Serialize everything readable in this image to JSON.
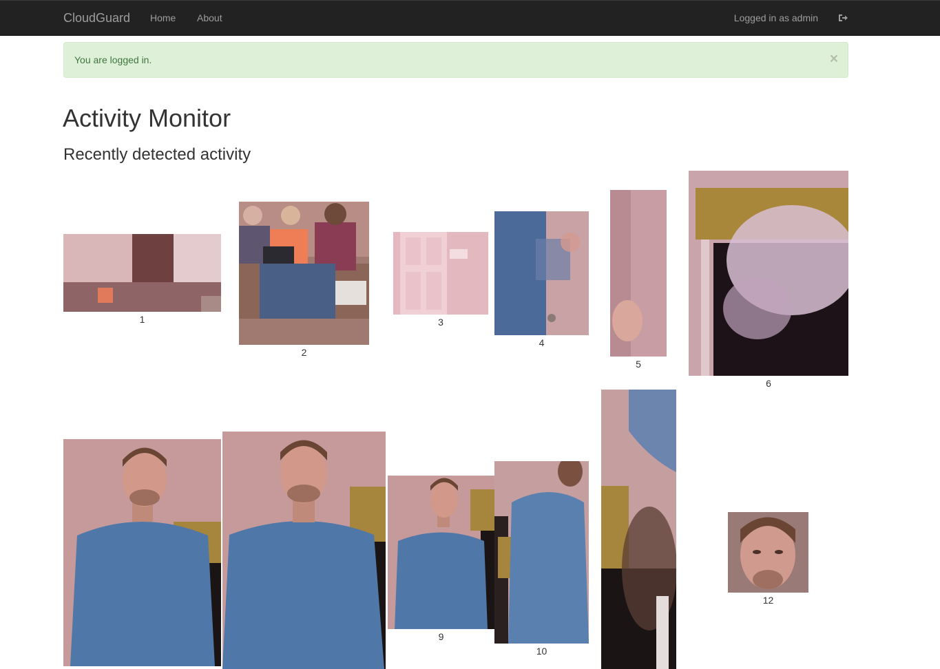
{
  "navbar": {
    "brand": "CloudGuard",
    "links": [
      "Home",
      "About"
    ],
    "user_text": "Logged in as admin",
    "logout_icon": "sign-out-icon"
  },
  "alert": {
    "message": "You are logged in.",
    "close_label": "×",
    "color": "#dff0d8"
  },
  "page": {
    "title": "Activity Monitor",
    "subtitle": "Recently detected activity"
  },
  "detections": [
    {
      "label": "1",
      "scene": "living room wide view"
    },
    {
      "label": "2",
      "scene": "three people on couch with laptop"
    },
    {
      "label": "3",
      "scene": "white door"
    },
    {
      "label": "4",
      "scene": "person in blue shirt moving, blurred"
    },
    {
      "label": "5",
      "scene": "motion blur close-up"
    },
    {
      "label": "6",
      "scene": "window with curtain, motion blur"
    },
    {
      "label": "",
      "scene": "man in blue shirt standing"
    },
    {
      "label": "",
      "scene": "man in blue shirt standing closer"
    },
    {
      "label": "9",
      "scene": "man in blue shirt standing"
    },
    {
      "label": "10",
      "scene": "person in blue shirt walking, blurred"
    },
    {
      "label": "",
      "scene": "motion blur dark doorway"
    },
    {
      "label": "12",
      "scene": "face close-up"
    }
  ]
}
